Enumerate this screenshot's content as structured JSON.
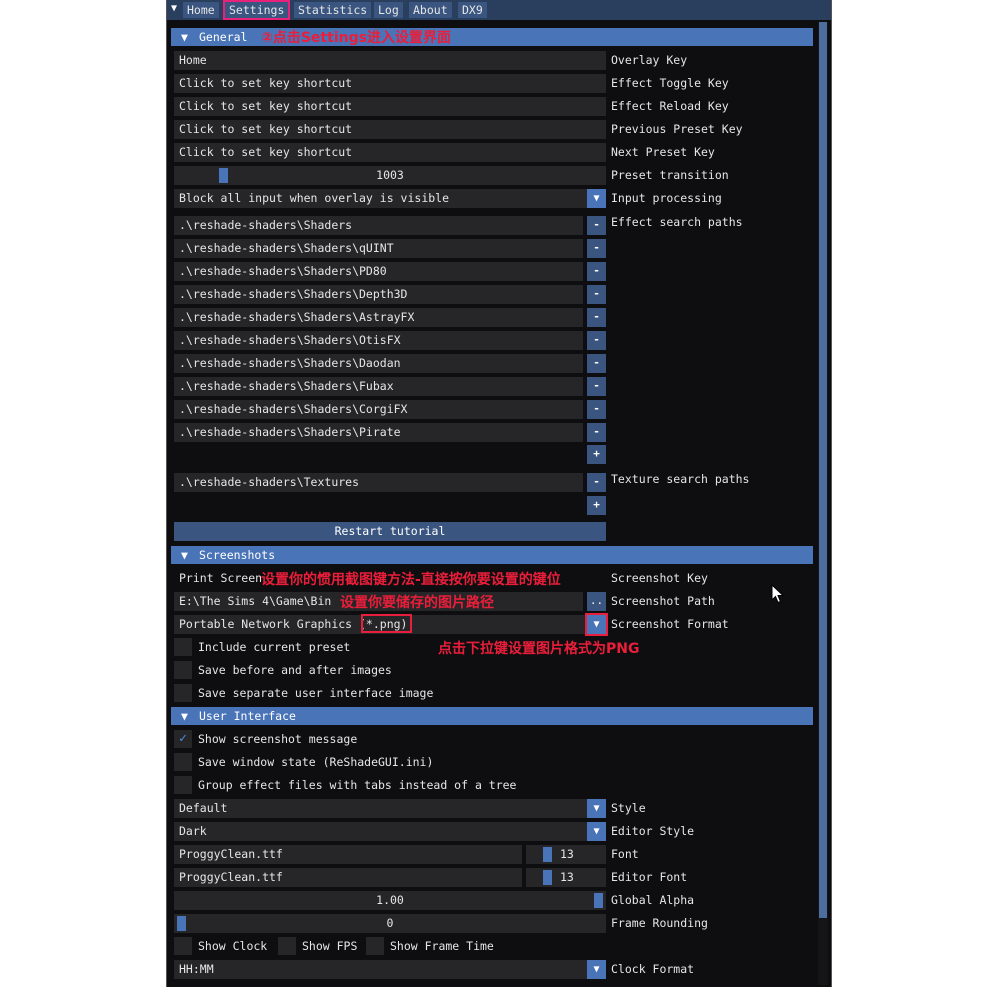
{
  "menu": {
    "tabs": [
      "Home",
      "Settings",
      "Statistics",
      "Log",
      "About",
      "DX9"
    ]
  },
  "general": {
    "header": "General",
    "annotation": "②点击Settings进入设置界面",
    "overlay_key": {
      "value": "Home",
      "label": "Overlay Key"
    },
    "effect_toggle_key": {
      "value": "Click to set key shortcut",
      "label": "Effect Toggle Key"
    },
    "effect_reload_key": {
      "value": "Click to set key shortcut",
      "label": "Effect Reload Key"
    },
    "previous_preset_key": {
      "value": "Click to set key shortcut",
      "label": "Previous Preset Key"
    },
    "next_preset_key": {
      "value": "Click to set key shortcut",
      "label": "Next Preset Key"
    },
    "preset_transition": {
      "value": "1003",
      "label": "Preset transition"
    },
    "input_processing": {
      "value": "Block all input when overlay is visible",
      "label": "Input processing"
    },
    "effect_search_paths": {
      "label": "Effect search paths",
      "paths": [
        ".\\reshade-shaders\\Shaders",
        ".\\reshade-shaders\\Shaders\\qUINT",
        ".\\reshade-shaders\\Shaders\\PD80",
        ".\\reshade-shaders\\Shaders\\Depth3D",
        ".\\reshade-shaders\\Shaders\\AstrayFX",
        ".\\reshade-shaders\\Shaders\\OtisFX",
        ".\\reshade-shaders\\Shaders\\Daodan",
        ".\\reshade-shaders\\Shaders\\Fubax",
        ".\\reshade-shaders\\Shaders\\CorgiFX",
        ".\\reshade-shaders\\Shaders\\Pirate"
      ]
    },
    "texture_search_paths": {
      "label": "Texture search paths",
      "paths": [
        ".\\reshade-shaders\\Textures"
      ]
    },
    "remove_label": "-",
    "add_label": "+",
    "restart_tutorial": "Restart tutorial"
  },
  "screenshots": {
    "header": "Screenshots",
    "key": {
      "value": "Print Screen",
      "label": "Screenshot Key"
    },
    "path": {
      "value": "E:\\The Sims 4\\Game\\Bin",
      "label": "Screenshot Path",
      "browse": ".."
    },
    "format": {
      "value": "Portable Network Graphics (*.png)",
      "label": "Screenshot Format"
    },
    "include_preset": "Include current preset",
    "save_before_after": "Save before and after images",
    "save_separate_ui": "Save separate user interface image",
    "annotation_key": "设置你的惯用截图键方法-直接按你要设置的键位",
    "annotation_path": "设置你要储存的图片路径",
    "annotation_format": "点击下拉键设置图片格式为PNG"
  },
  "user_interface": {
    "header": "User Interface",
    "show_screenshot_message": {
      "label": "Show screenshot message",
      "checked": true
    },
    "save_window_state": {
      "label": "Save window state (ReShadeGUI.ini)",
      "checked": false
    },
    "group_effect_files": {
      "label": "Group effect files with tabs instead of a tree",
      "checked": false
    },
    "style": {
      "value": "Default",
      "label": "Style"
    },
    "editor_style": {
      "value": "Dark",
      "label": "Editor Style"
    },
    "font": {
      "value": "ProggyClean.ttf",
      "size": "13",
      "label": "Font"
    },
    "editor_font": {
      "value": "ProggyClean.ttf",
      "size": "13",
      "label": "Editor Font"
    },
    "global_alpha": {
      "value": "1.00",
      "label": "Global Alpha"
    },
    "frame_rounding": {
      "value": "0",
      "label": "Frame Rounding"
    },
    "show_clock": "Show Clock",
    "show_fps": "Show FPS",
    "show_frame_time": "Show Frame Time",
    "clock_format": {
      "value": "HH:MM",
      "label": "Clock Format"
    }
  },
  "icons": {
    "menu": "triangle-down-icon",
    "dropdown": "triangle-down-icon",
    "check": "check-icon",
    "cursor": "mouse-pointer-icon"
  },
  "colors": {
    "accent": "#4a74b8",
    "annotation": "#ea1e3a",
    "highlight_box": "#e8227a"
  }
}
